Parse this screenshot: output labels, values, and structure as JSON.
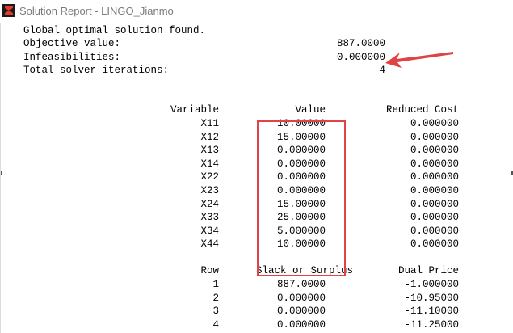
{
  "window": {
    "title": "Solution Report - LINGO_Jianmo",
    "icon": "lingo-app-icon"
  },
  "summary": {
    "status": "Global optimal solution found.",
    "objective_label": "Objective value:",
    "objective_value": "887.0000",
    "infeasibilities_label": "Infeasibilities:",
    "infeasibilities_value": "0.000000",
    "iterations_label": "Total solver iterations:",
    "iterations_value": "4"
  },
  "variables_table": {
    "headers": {
      "variable": "Variable",
      "value": "Value",
      "reduced_cost": "Reduced Cost"
    },
    "rows": [
      {
        "variable": "X11",
        "value": "10.00000",
        "reduced_cost": "0.000000"
      },
      {
        "variable": "X12",
        "value": "15.00000",
        "reduced_cost": "0.000000"
      },
      {
        "variable": "X13",
        "value": "0.000000",
        "reduced_cost": "0.000000"
      },
      {
        "variable": "X14",
        "value": "0.000000",
        "reduced_cost": "0.000000"
      },
      {
        "variable": "X22",
        "value": "0.000000",
        "reduced_cost": "0.000000"
      },
      {
        "variable": "X23",
        "value": "0.000000",
        "reduced_cost": "0.000000"
      },
      {
        "variable": "X24",
        "value": "15.00000",
        "reduced_cost": "0.000000"
      },
      {
        "variable": "X33",
        "value": "25.00000",
        "reduced_cost": "0.000000"
      },
      {
        "variable": "X34",
        "value": "5.000000",
        "reduced_cost": "0.000000"
      },
      {
        "variable": "X44",
        "value": "10.00000",
        "reduced_cost": "0.000000"
      }
    ]
  },
  "rows_table": {
    "headers": {
      "row": "Row",
      "slack": "Slack or Surplus",
      "dual_price": "Dual Price"
    },
    "rows": [
      {
        "row": "1",
        "slack": "887.0000",
        "dual_price": "-1.000000"
      },
      {
        "row": "2",
        "slack": "0.000000",
        "dual_price": "-10.95000"
      },
      {
        "row": "3",
        "slack": "0.000000",
        "dual_price": "-11.10000"
      },
      {
        "row": "4",
        "slack": "0.000000",
        "dual_price": "-11.25000"
      }
    ]
  },
  "annotations": {
    "highlight_color": "#e04343",
    "arrow_color": "#e04343"
  }
}
